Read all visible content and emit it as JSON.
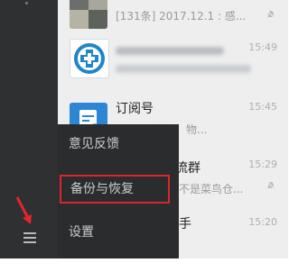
{
  "sidebar": {
    "menu_icon": "hamburger-menu-icon",
    "annotation_color": "#e4262b"
  },
  "chats": [
    {
      "name": "",
      "preview": "[131条] 2017.12.1 : 感...",
      "time": "",
      "muted": true,
      "avatar": "group-photo-avatar"
    },
    {
      "name": "",
      "preview": "",
      "time": "15:49",
      "muted": false,
      "avatar": "blue-cross-logo-avatar"
    },
    {
      "name": "订阅号",
      "preview": "互联网，物...",
      "time": "15:45",
      "muted": false,
      "avatar": "subscription-doc-icon"
    },
    {
      "name": "流群",
      "preview": "不是菜鸟仓...",
      "time": "15:29",
      "muted": true,
      "avatar": "group-avatar"
    },
    {
      "name": "手",
      "preview": "",
      "time": "15:20",
      "muted": false,
      "avatar": "contact-avatar"
    }
  ],
  "menu": {
    "items": [
      {
        "label": "意见反馈"
      },
      {
        "label": "备份与恢复",
        "highlighted": true,
        "highlight_color": "#d8262c"
      },
      {
        "label": "设置"
      }
    ]
  }
}
